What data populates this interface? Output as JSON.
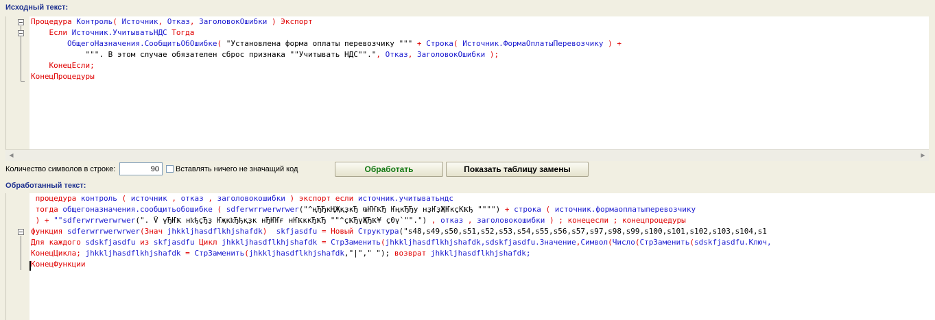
{
  "source": {
    "label": "Исходный текст:",
    "lines": [
      [
        {
          "t": "Процедура ",
          "c": "kw"
        },
        {
          "t": "Контроль",
          "c": "id"
        },
        {
          "t": "( ",
          "c": "kw"
        },
        {
          "t": "Источник",
          "c": "id"
        },
        {
          "t": ", ",
          "c": "kw"
        },
        {
          "t": "Отказ",
          "c": "id"
        },
        {
          "t": ", ",
          "c": "kw"
        },
        {
          "t": "ЗаголовокОшибки",
          "c": "id"
        },
        {
          "t": " ) ",
          "c": "kw"
        },
        {
          "t": "Экспорт",
          "c": "kw"
        }
      ],
      [
        {
          "t": "    Если ",
          "c": "kw"
        },
        {
          "t": "Источник.УчитыватьНДС",
          "c": "id"
        },
        {
          "t": " Тогда",
          "c": "kw"
        }
      ],
      [
        {
          "t": "        ОбщегоНазначения.СообщитьОбОшибке",
          "c": "id"
        },
        {
          "t": "( ",
          "c": "kw"
        },
        {
          "t": "\"Установлена форма оплаты перевозчику \"\"\"",
          "c": "str"
        },
        {
          "t": " + ",
          "c": "kw"
        },
        {
          "t": "Строка",
          "c": "id"
        },
        {
          "t": "( ",
          "c": "kw"
        },
        {
          "t": "Источник.ФормаОплатыПеревозчику",
          "c": "id"
        },
        {
          "t": " ) +",
          "c": "kw"
        }
      ],
      [
        {
          "t": "            \"\"\". В этом случае обязателен сброс признака \"\"Учитывать НДС\"\".\"",
          "c": "str"
        },
        {
          "t": ", ",
          "c": "kw"
        },
        {
          "t": "Отказ",
          "c": "id"
        },
        {
          "t": ", ",
          "c": "kw"
        },
        {
          "t": "ЗаголовокОшибки",
          "c": "id"
        },
        {
          "t": " );",
          "c": "kw"
        }
      ],
      [
        {
          "t": "    КонецЕсли;",
          "c": "kw"
        }
      ],
      [
        {
          "t": "КонецПроцедуры",
          "c": "kw"
        }
      ]
    ]
  },
  "controls": {
    "count_label": "Количество символов в строке:",
    "count_value": "90",
    "checkbox_label": "Вставлять ничего не значащий код",
    "process_button": "Обработать",
    "table_button": "Показать таблицу замены"
  },
  "result": {
    "label": "Обработанный текст:",
    "lines": [
      [
        {
          "t": " процедура ",
          "c": "kw"
        },
        {
          "t": "контроль",
          "c": "id"
        },
        {
          "t": " ( ",
          "c": "kw"
        },
        {
          "t": "источник",
          "c": "id"
        },
        {
          "t": " , ",
          "c": "kw"
        },
        {
          "t": "отказ",
          "c": "id"
        },
        {
          "t": " , ",
          "c": "kw"
        },
        {
          "t": "заголовокошибки",
          "c": "id"
        },
        {
          "t": " ) экспорт если ",
          "c": "kw"
        },
        {
          "t": "источник.учитыватьндс",
          "c": "id"
        }
      ],
      [
        {
          "t": " тогда ",
          "c": "kw"
        },
        {
          "t": "общегоназначения.сообщитьобошибке",
          "c": "id"
        },
        {
          "t": " ( ",
          "c": "kw"
        },
        {
          "t": "sdferwrrwerwrwer",
          "c": "id"
        },
        {
          "t": "(\"^ңЂЂкҢҖқҙкЂ ҨҤҤҜЂ ҤңкЂЂу нҙҤҙҖҤкҫКҜђ \"\"\"\")",
          "c": "str"
        },
        {
          "t": " + ",
          "c": "kw"
        },
        {
          "t": "строка",
          "c": "id"
        },
        {
          "t": " ( ",
          "c": "kw"
        },
        {
          "t": "источник.формаоплатыперевозчику",
          "c": "id"
        }
      ],
      [
        {
          "t": " ) + ",
          "c": "kw"
        },
        {
          "t": "\"\"sdferwrrwerwrwer",
          "c": "id"
        },
        {
          "t": "(\". Ṽ ұЂҤҜ нҟђҫЂҙ ҤҗкҟЂђқҙк нЂҤҤғ нҤҜккЂҜЂ \"\"^ҫҜЂұҖЂҜ¥ ҫ0ү`\"\".\")",
          "c": "str"
        },
        {
          "t": " , ",
          "c": "kw"
        },
        {
          "t": "отказ",
          "c": "id"
        },
        {
          "t": " , ",
          "c": "kw"
        },
        {
          "t": "заголовокошибки",
          "c": "id"
        },
        {
          "t": " ) ; конецесли ; конецпроцедуры",
          "c": "kw"
        }
      ],
      [
        {
          "t": "функция ",
          "c": "kw"
        },
        {
          "t": "sdferwrrwerwrwer",
          "c": "id"
        },
        {
          "t": "(Знач ",
          "c": "kw"
        },
        {
          "t": "jhkkljhasdflkhjshafdk",
          "c": "id"
        },
        {
          "t": ")  ",
          "c": "kw"
        },
        {
          "t": "skfjasdfu",
          "c": "id"
        },
        {
          "t": " = Новый ",
          "c": "kw"
        },
        {
          "t": "Структура",
          "c": "id"
        },
        {
          "t": "(\"s48,s49,s50,s51,s52,s53,s54,s55,s56,s57,s97,s98,s99,s100,s101,s102,s103,s104,s1",
          "c": "str"
        }
      ],
      [
        {
          "t": "Для каждого ",
          "c": "kw"
        },
        {
          "t": "sdskfjasdfu",
          "c": "id"
        },
        {
          "t": " из ",
          "c": "kw"
        },
        {
          "t": "skfjasdfu",
          "c": "id"
        },
        {
          "t": " Цикл ",
          "c": "kw"
        },
        {
          "t": "jhkkljhasdflkhjshafdk",
          "c": "id"
        },
        {
          "t": " = ",
          "c": "kw"
        },
        {
          "t": "СтрЗаменить",
          "c": "id"
        },
        {
          "t": "(",
          "c": "kw"
        },
        {
          "t": "jhkkljhasdflkhjshafdk,sdskfjasdfu.Значение",
          "c": "id"
        },
        {
          "t": ",",
          "c": "kw"
        },
        {
          "t": "Символ",
          "c": "id"
        },
        {
          "t": "(",
          "c": "kw"
        },
        {
          "t": "Число",
          "c": "id"
        },
        {
          "t": "(",
          "c": "kw"
        },
        {
          "t": "СтрЗаменить",
          "c": "id"
        },
        {
          "t": "(",
          "c": "kw"
        },
        {
          "t": "sdskfjasdfu.Ключ,",
          "c": "id"
        }
      ],
      [
        {
          "t": "КонецЦикла; ",
          "c": "kw"
        },
        {
          "t": "jhkkljhasdflkhjshafdk",
          "c": "id"
        },
        {
          "t": " = ",
          "c": "kw"
        },
        {
          "t": "СтрЗаменить",
          "c": "id"
        },
        {
          "t": "(",
          "c": "kw"
        },
        {
          "t": "jhkkljhasdflkhjshafdk",
          "c": "id"
        },
        {
          "t": ",\"|\",\" \"); ",
          "c": "str"
        },
        {
          "t": "возврат ",
          "c": "kw"
        },
        {
          "t": "jhkkljhasdflkhjshafdk;",
          "c": "id"
        }
      ],
      [
        {
          "t": "КонецФункции",
          "c": "kw"
        }
      ]
    ]
  }
}
